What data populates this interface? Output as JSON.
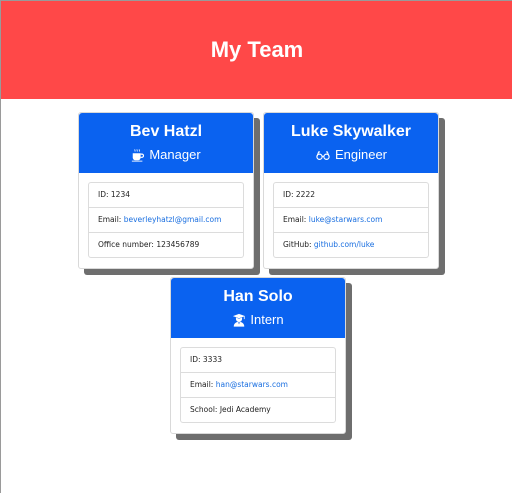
{
  "header": {
    "title": "My Team"
  },
  "team": [
    {
      "name": "Bev Hatzl",
      "role": "Manager",
      "icon": "coffee-icon",
      "id_label": "ID: ",
      "id": "1234",
      "email_label": "Email: ",
      "email": "beverleyhatzl@gmail.com",
      "extra_label": "Office number: ",
      "extra": "123456789"
    },
    {
      "name": "Luke Skywalker",
      "role": "Engineer",
      "icon": "glasses-icon",
      "id_label": "ID: ",
      "id": "2222",
      "email_label": "Email: ",
      "email": "luke@starwars.com",
      "extra_label": "GitHub: ",
      "extra": "github.com/luke"
    },
    {
      "name": "Han Solo",
      "role": "Intern",
      "icon": "graduate-icon",
      "id_label": "ID: ",
      "id": "3333",
      "email_label": "Email: ",
      "email": "han@starwars.com",
      "extra_label": "School: ",
      "extra": "Jedi Academy"
    }
  ],
  "colors": {
    "header_bg": "#ff4848",
    "card_head_bg": "#0a62f0",
    "link": "#1a6fe0"
  }
}
